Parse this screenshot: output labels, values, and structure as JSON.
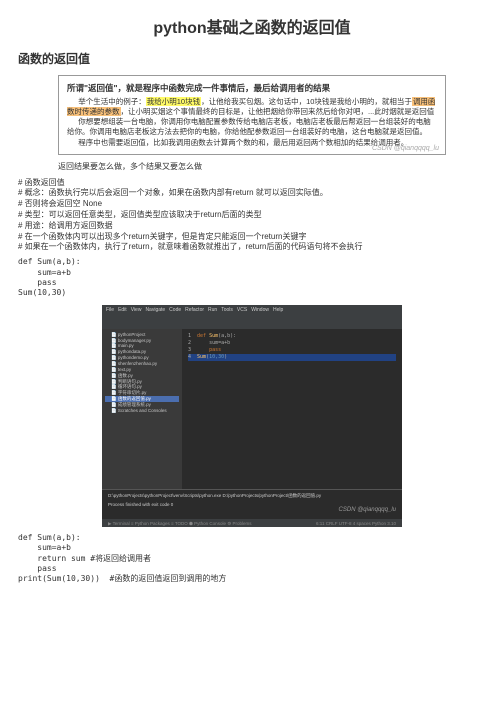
{
  "title": "python基础之函数的返回值",
  "section": "函数的返回值",
  "box": {
    "title": "所谓\"返回值\"，就是程序中函数完成一件事情后，最后给调用者的结果",
    "l1": "举个生活中的例子：",
    "hl1": "我给小明10块钱",
    "l1b": "，让他给我买包烟。这句话中，10块钱是我给小明的，就相当于",
    "hl2": "调用函数时传递的参数",
    "l1c": "，让小明买烟这个事情最终的目标是，让他把烟给你带回来然后给你对吧，...此时烟就是返回值",
    "l2": "你想要想组装一台电脑，你调用你电脑配置参数传给电脑店老板，电脑店老板最后帮返回一台组装好的电脑给你。你调用电脑店老板这方法去把你的电脑，你给他配参数返回一台组装好的电脑，这台电脑就是返回值。",
    "l3": "程序中也需要返回值，比如我调用函数去计算两个数的和，最后用返回两个数相加的结果给调用者。",
    "wm": "CSDN @qianqqqq_lu"
  },
  "subtext": "返回结果要怎么做，多个结果又要怎么做",
  "bullets": [
    "# 函数返回值",
    "# 概念：函数执行完以后会返回一个对象，如果在函数内部有return 就可以返回实际值。",
    "# 否则将会返回空 None",
    "# 类型：可以返回任意类型，返回值类型应该取决于return后面的类型",
    "# 用途：给调用方返回数据",
    "# 在一个函数体内可以出现多个return关键字，但是肯定只能返回一个return关键字",
    "# 如果在一个函数体内，执行了return，就意味着函数就推出了，return后面的代码语句将不会执行"
  ],
  "code1": "def Sum(a,b):\n    sum=a+b\n    pass\nSum(10,30)",
  "ide": {
    "menu": [
      "File",
      "Edit",
      "View",
      "Navigate",
      "Code",
      "Refactor",
      "Run",
      "Tools",
      "VCS",
      "Window",
      "Help"
    ],
    "tree": [
      "pythonProject",
      "bodymanager.py",
      "main.py",
      "pythondata.py",
      "pythondemo.py",
      "shenfenzhenhao.py",
      "text.py",
      "函数.py",
      "判断语句.py",
      "循环语句.py",
      "字符串切片.py",
      "函数的返回值.py",
      "成绩管理系统.py",
      "Scratches and Consoles"
    ],
    "tree_selected": 11,
    "editor": [
      {
        "kw": "def ",
        "fn": "Sum",
        "txt": "(a,b):"
      },
      {
        "txt": "    sum=a+b"
      },
      {
        "txt": "    ",
        "kw2": "pass"
      },
      {
        "fn": "Sum",
        "txt": "(",
        "num": "10,30",
        "txt2": ")"
      }
    ],
    "console_cmd": "D:\\pythonProjects\\pythonProject\\venv\\Scripts\\python.exe D:/pythonProjects/pythonProject/函数的返回值.py",
    "console_out": "Process finished with exit code 0",
    "status_left": "▶ Terminal  ≡ Python Packages  ≡ TODO  ⬢ Python Console  ⚙ Problems",
    "status_right": "6:11  CRLF  UTF-8  4 spaces  Python 3.10",
    "wm": "CSDN @qianqqqq_lu"
  },
  "code2": "def Sum(a,b):\n    sum=a+b\n    return sum #将返回给调用者\n    pass\nprint(Sum(10,30))  #函数的返回值返回到调用的地方"
}
